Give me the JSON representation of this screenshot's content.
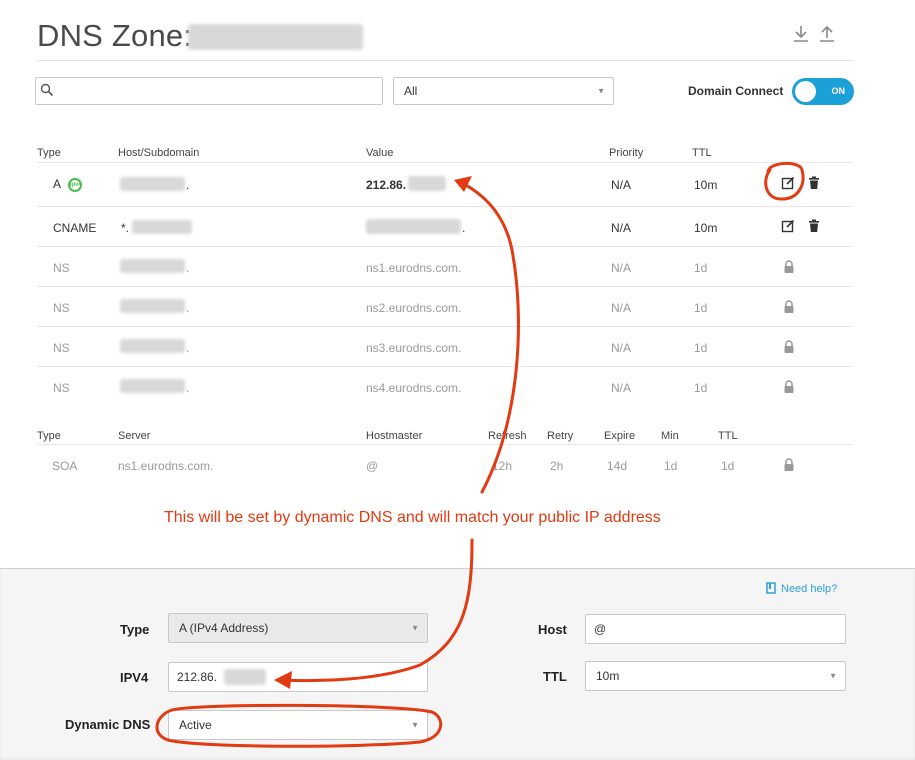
{
  "header": {
    "title": "DNS Zone:",
    "download_icon": "download-icon",
    "upload_icon": "upload-icon"
  },
  "toolbar": {
    "search_placeholder": "",
    "filter_selected": "All",
    "domain_connect_label": "Domain Connect",
    "toggle_state": "ON"
  },
  "records": {
    "headers": {
      "type": "Type",
      "host": "Host/Subdomain",
      "value": "Value",
      "priority": "Priority",
      "ttl": "TTL"
    },
    "rows": [
      {
        "type": "A",
        "host": ".",
        "value": "212.86.",
        "priority": "N/A",
        "ttl": "10m"
      },
      {
        "type": "CNAME",
        "host": "*.",
        "value": ".",
        "priority": "N/A",
        "ttl": "10m"
      },
      {
        "type": "NS",
        "host": ".",
        "value": "ns1.eurodns.com.",
        "priority": "N/A",
        "ttl": "1d"
      },
      {
        "type": "NS",
        "host": ".",
        "value": "ns2.eurodns.com.",
        "priority": "N/A",
        "ttl": "1d"
      },
      {
        "type": "NS",
        "host": ".",
        "value": "ns3.eurodns.com.",
        "priority": "N/A",
        "ttl": "1d"
      },
      {
        "type": "NS",
        "host": ".",
        "value": "ns4.eurodns.com.",
        "priority": "N/A",
        "ttl": "1d"
      }
    ]
  },
  "soa": {
    "headers": {
      "type": "Type",
      "server": "Server",
      "hostmaster": "Hostmaster",
      "refresh": "Refresh",
      "retry": "Retry",
      "expire": "Expire",
      "min": "Min",
      "ttl": "TTL"
    },
    "row": {
      "type": "SOA",
      "server": "ns1.eurodns.com.",
      "hostmaster": "@",
      "refresh": "12h",
      "retry": "2h",
      "expire": "14d",
      "min": "1d",
      "ttl": "1d"
    }
  },
  "annotation": {
    "text": "This will be set by dynamic DNS and will match your public IP address",
    "color": "#e23a12"
  },
  "form": {
    "help_label": "Need help?",
    "type_label": "Type",
    "type_value": "A (IPv4 Address)",
    "ipv4_label": "IPV4",
    "ipv4_value": "212.86.",
    "dynamic_label": "Dynamic DNS",
    "dynamic_value": "Active",
    "host_label": "Host",
    "host_value": "@",
    "ttl_label": "TTL",
    "ttl_value": "10m"
  },
  "colors": {
    "accent": "#1ca0d8",
    "annotation": "#e23a12",
    "a_badge": "#4cbb4c"
  }
}
